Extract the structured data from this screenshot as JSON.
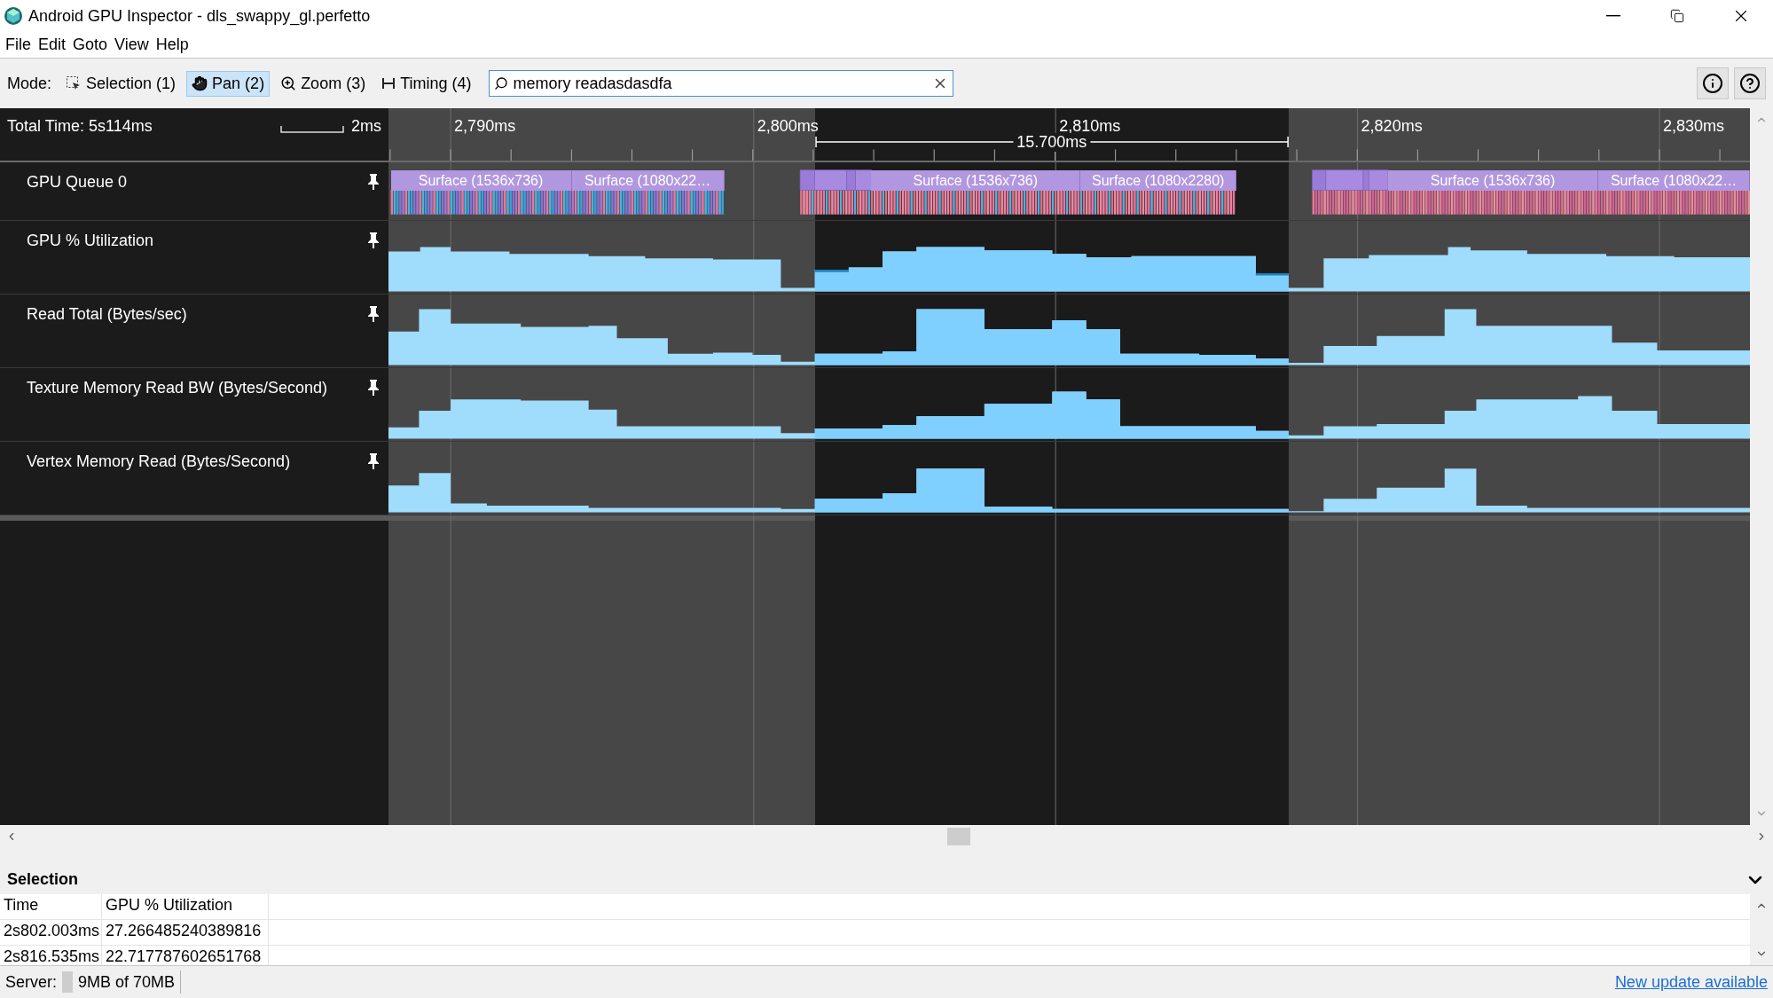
{
  "window": {
    "title": "Android GPU Inspector - dls_swappy_gl.perfetto"
  },
  "menu": [
    "File",
    "Edit",
    "Goto",
    "View",
    "Help"
  ],
  "toolbar": {
    "mode_label": "Mode:",
    "modes": [
      {
        "label": "Selection (1)",
        "selected": false
      },
      {
        "label": "Pan (2)",
        "selected": true
      },
      {
        "label": "Zoom (3)",
        "selected": false
      },
      {
        "label": "Timing (4)",
        "selected": false
      }
    ],
    "search": {
      "value": "memory readasdasdfa"
    }
  },
  "timeline": {
    "total_time": "Total Time: 5s114ms",
    "scale": "2ms",
    "ticks": [
      "2,790ms",
      "2,800ms",
      "2,810ms",
      "2,820ms",
      "2,830ms"
    ],
    "selection_duration": "15.700ms",
    "tracks": [
      {
        "kind": "slices",
        "name": "GPU Queue 0",
        "slices": [
          {
            "label": "Surface (1536x736)"
          },
          {
            "label": "Surface (1080x22…"
          },
          {
            "label": "Surface (1536x736)"
          },
          {
            "label": "Surface (1080x2280)"
          },
          {
            "label": "Surface (1536x736)"
          },
          {
            "label": "Surface (1080x22…"
          }
        ]
      },
      {
        "kind": "counter",
        "name": "GPU % Utilization"
      },
      {
        "kind": "counter",
        "name": "Read Total (Bytes/sec)"
      },
      {
        "kind": "counter",
        "name": "Texture Memory Read BW (Bytes/Second)"
      },
      {
        "kind": "counter",
        "name": "Vertex Memory Read (Bytes/Second)"
      }
    ]
  },
  "selection_panel": {
    "title": "Selection",
    "columns": [
      "Time",
      "GPU % Utilization"
    ],
    "rows": [
      [
        "2s802.003ms",
        "27.266485240389816"
      ],
      [
        "2s816.535ms",
        "22.717787602651768"
      ]
    ]
  },
  "status_bar": {
    "server_label": "Server:",
    "memory": "9MB of 70MB",
    "update_link": "New update available"
  }
}
